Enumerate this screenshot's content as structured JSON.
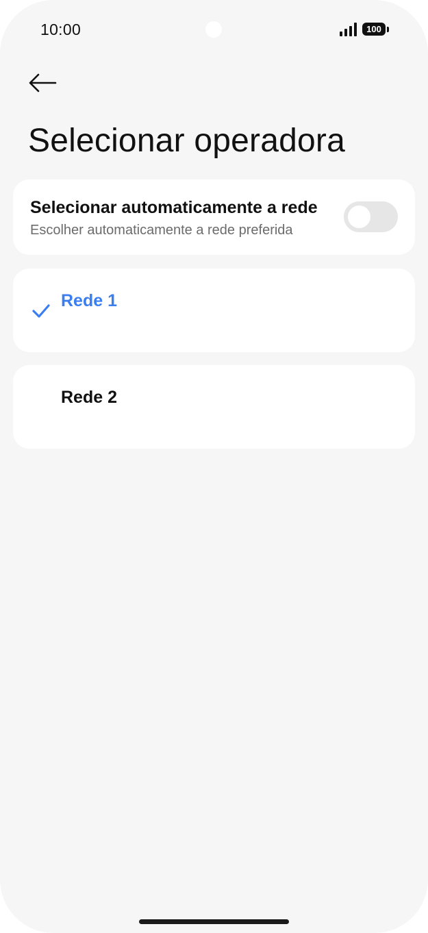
{
  "status_bar": {
    "time": "10:00",
    "battery": "100",
    "icons": [
      "signal-icon",
      "battery-icon"
    ]
  },
  "header": {
    "back_icon": "arrow-left-icon",
    "title": "Selecionar operadora"
  },
  "auto_select": {
    "title": "Selecionar automaticamente a rede",
    "subtitle": "Escolher automaticamente a rede preferida",
    "enabled": false
  },
  "networks": [
    {
      "label": "Rede 1",
      "selected": true
    },
    {
      "label": "Rede 2",
      "selected": false
    }
  ],
  "colors": {
    "background": "#f6f6f6",
    "card": "#ffffff",
    "accent": "#3a7ef0",
    "toggle_off": "#e6e6e6",
    "text": "#111111",
    "subtext": "#6b6b6b"
  }
}
